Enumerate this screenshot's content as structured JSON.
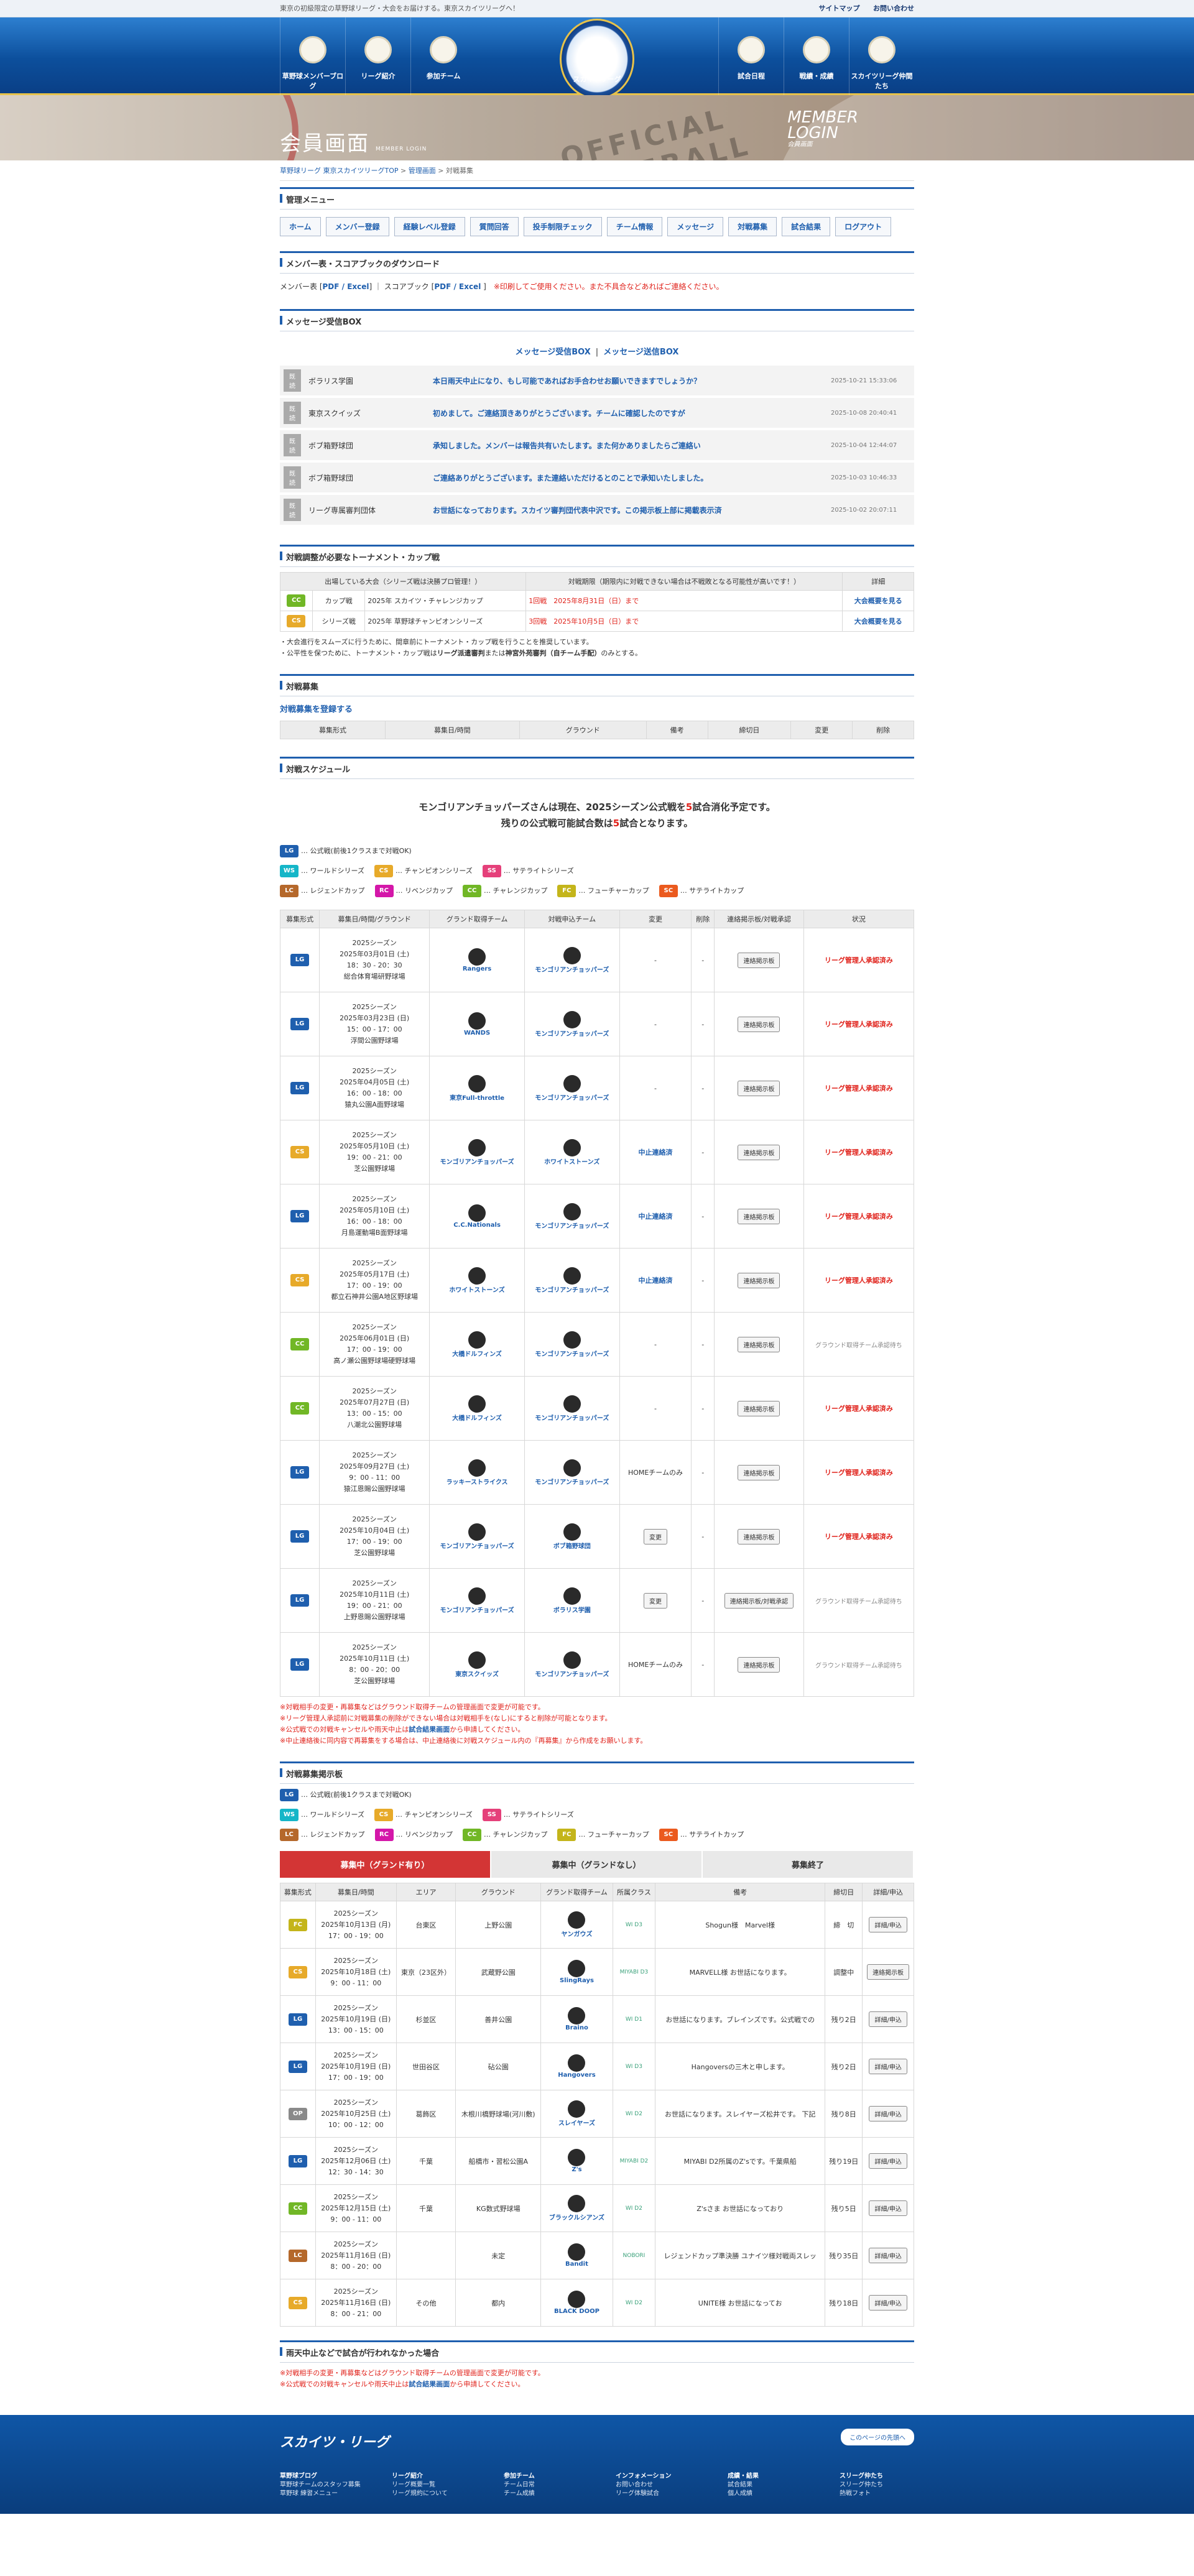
{
  "topbar": {
    "tagline": "東京の初級限定の草野球リーグ・大会をお届けする。東京スカイツリーグへ！",
    "sitemap": "サイトマップ",
    "contact": "お問い合わせ"
  },
  "nav": {
    "left": [
      "草野球メンバーブログ",
      "リーグ紹介",
      "参加チーム"
    ],
    "right": [
      "試合日程",
      "戦績・成績",
      "スカイツリーグ仲間たち"
    ],
    "logo": "スカイツリーグ"
  },
  "hero": {
    "title": "会員画面",
    "title_en": "MEMBER LOGIN",
    "en_title": "MEMBER",
    "en_title2": "LOGIN",
    "en_sub": "会員画面",
    "stamp": "OFFICIAL BASEBALL"
  },
  "breadcrumb": {
    "home": "草野球リーグ 東京スカイツリーグTOP",
    "member": "管理画面",
    "current": "対戦募集"
  },
  "admin_menu": {
    "heading": "管理メニュー",
    "items": [
      "ホーム",
      "メンバー登録",
      "経験レベル登録",
      "質問回答",
      "投手制限チェック",
      "チーム情報",
      "メッセージ",
      "対戦募集",
      "試合結果",
      "ログアウト"
    ]
  },
  "download": {
    "heading": "メンバー表・スコアブックのダウンロード",
    "member_label": "メンバー表 [",
    "member_link": "PDF / Excel",
    "score_label": "] ｜ スコアブック [",
    "score_link": "PDF / Excel",
    "note": "※印刷してご使用ください。また不具合などあればご連絡ください。"
  },
  "messages": {
    "heading": "メッセージ受信BOX",
    "recv": "メッセージ受信BOX",
    "sent": "メッセージ送信BOX",
    "sep": "|",
    "items": [
      {
        "tag": "既読",
        "from": "ボラリス学園",
        "body": "本日雨天中止になり、もし可能であればお手合わせお願いできますでしょうか？",
        "date": "2025-10-21 15:33:06"
      },
      {
        "tag": "既読",
        "from": "東京スクイッズ",
        "body": "初めまして。ご連絡頂きありがとうございます。チームに確認したのですが",
        "date": "2025-10-08 20:40:41"
      },
      {
        "tag": "既読",
        "from": "ボブ箱野球団",
        "body": "承知しました。メンバーは報告共有いたします。また何かありましたらご連絡い",
        "date": "2025-10-04 12:44:07"
      },
      {
        "tag": "既読",
        "from": "ボブ箱野球団",
        "body": "ご連絡ありがとうございます。また連絡いただけるとのことで承知いたしました。",
        "date": "2025-10-03 10:46:33"
      },
      {
        "tag": "既読",
        "from": "リーグ専属審判団体",
        "body": "お世話になっております。スカイツ審判団代表中沢です。この掲示板上部に掲載表示済",
        "date": "2025-10-02 20:07:11"
      }
    ]
  },
  "tournament": {
    "heading": "対戦調整が必要なトーナメント・カップ戦",
    "cols": [
      "出場している大会（シリーズ戦は決勝プロ管理！）",
      "対戦期限（期限内に対戦できない場合は不戦敗となる可能性が高いです！）",
      "詳細"
    ],
    "rows": [
      {
        "badge": "CC",
        "type": "カップ戦",
        "name": "2025年 スカイツ・チャレンジカップ",
        "deadline": "1回戦　2025年8月31日（日）まで",
        "link": "大会概要を見る"
      },
      {
        "badge": "CS",
        "type": "シリーズ戦",
        "name": "2025年 草野球チャンピオンシリーズ",
        "deadline": "3回戦　2025年10月5日（日）まで",
        "link": "大会概要を見る"
      }
    ],
    "note1": "・大会進行をスムーズに行うために、間章前にトーナメント・カップ戦を行うことを推奨しています。",
    "note2_a": "・公平性を保つために、トーナメント・カップ戦は",
    "note2_b": "リーグ派遣審判",
    "note2_c": "または",
    "note2_d": "神宮外苑審判（自チーム手配）",
    "note2_e": "のみとする。"
  },
  "recruit": {
    "heading": "対戦募集",
    "add": "対戦募集を登録する",
    "cols": [
      "募集形式",
      "募集日/時間",
      "グラウンド",
      "備考",
      "締切日",
      "変更",
      "削除"
    ]
  },
  "schedule": {
    "heading": "対戦スケジュール",
    "summary_a": "モンゴリアンチョッパーズさんは現在、2025シーズン公式戦を",
    "summary_n1": "5",
    "summary_b": "試合消化予定です。",
    "summary_c": "残りの公式戦可能試合数は",
    "summary_n2": "5",
    "summary_d": "試合となります。",
    "legend": [
      [
        {
          "b": "LG",
          "t": "… 公式戦(前後1クラスまで対戦OK)"
        }
      ],
      [
        {
          "b": "WS",
          "t": "… ワールドシリーズ"
        },
        {
          "b": "CS",
          "t": "… チャンピオンシリーズ"
        },
        {
          "b": "SS",
          "t": "… サテライトシリーズ"
        }
      ],
      [
        {
          "b": "LC",
          "t": "… レジェンドカップ"
        },
        {
          "b": "RC",
          "t": "… リベンジカップ"
        },
        {
          "b": "CC",
          "t": "… チャレンジカップ"
        },
        {
          "b": "FC",
          "t": "… フューチャーカップ"
        },
        {
          "b": "SC",
          "t": "… サテライトカップ"
        }
      ]
    ],
    "cols": [
      "募集形式",
      "募集日/時間/グラウンド",
      "グランド取得チーム",
      "対戦申込チーム",
      "変更",
      "削除",
      "連絡掲示板/対戦承認",
      "状況"
    ],
    "rows": [
      {
        "b": "LG",
        "season": "2025シーズン",
        "date": "2025年03月01日 (土)",
        "time": "18：30 - 20：30",
        "ground": "総合体育場研野球場",
        "home": "Rangers",
        "away": "モンゴリアンチョッパーズ",
        "change": "-",
        "del": "-",
        "action": "連絡掲示板",
        "status": "リーグ管理人承認済み",
        "sc": "red"
      },
      {
        "b": "LG",
        "season": "2025シーズン",
        "date": "2025年03月23日 (日)",
        "time": "15：00 - 17：00",
        "ground": "浮間公園野球場",
        "home": "WANDS",
        "away": "モンゴリアンチョッパーズ",
        "change": "-",
        "del": "-",
        "action": "連絡掲示板",
        "status": "リーグ管理人承認済み",
        "sc": "red"
      },
      {
        "b": "LG",
        "season": "2025シーズン",
        "date": "2025年04月05日 (土)",
        "time": "16：00 - 18：00",
        "ground": "猿丸公園A面野球場",
        "home": "東京Full-throttle",
        "away": "モンゴリアンチョッパーズ",
        "change": "-",
        "del": "-",
        "action": "連絡掲示板",
        "status": "リーグ管理人承認済み",
        "sc": "red"
      },
      {
        "b": "CS",
        "season": "2025シーズン",
        "date": "2025年05月10日 (土)",
        "time": "19：00 - 21：00",
        "ground": "芝公園野球場",
        "home": "モンゴリアンチョッパーズ",
        "away": "ホワイトストーンズ",
        "change": "中止連絡済",
        "del": "-",
        "action": "連絡掲示板",
        "status": "リーグ管理人承認済み",
        "sc": "red"
      },
      {
        "b": "LG",
        "season": "2025シーズン",
        "date": "2025年05月10日 (土)",
        "time": "16：00 - 18：00",
        "ground": "月島運動場B面野球場",
        "home": "C.C.Nationals",
        "away": "モンゴリアンチョッパーズ",
        "change": "中止連絡済",
        "del": "-",
        "action": "連絡掲示板",
        "status": "リーグ管理人承認済み",
        "sc": "red"
      },
      {
        "b": "CS",
        "season": "2025シーズン",
        "date": "2025年05月17日 (土)",
        "time": "17：00 - 19：00",
        "ground": "都立石神井公園A地区野球場",
        "home": "ホワイトストーンズ",
        "away": "モンゴリアンチョッパーズ",
        "change": "中止連絡済",
        "del": "-",
        "action": "連絡掲示板",
        "status": "リーグ管理人承認済み",
        "sc": "red"
      },
      {
        "b": "CC",
        "season": "2025シーズン",
        "date": "2025年06月01日 (日)",
        "time": "17：00 - 19：00",
        "ground": "高ノ瀬公園野球場硬野球場",
        "home": "大橋ドルフィンズ",
        "away": "モンゴリアンチョッパーズ",
        "change": "-",
        "del": "-",
        "action": "連絡掲示板",
        "status": "グラウンド取得チーム承認待ち",
        "sc": "gray"
      },
      {
        "b": "CC",
        "season": "2025シーズン",
        "date": "2025年07月27日 (日)",
        "time": "13：00 - 15：00",
        "ground": "八潮北公園野球場",
        "home": "大橋ドルフィンズ",
        "away": "モンゴリアンチョッパーズ",
        "change": "-",
        "del": "-",
        "action": "連絡掲示板",
        "status": "リーグ管理人承認済み",
        "sc": "red"
      },
      {
        "b": "LG",
        "season": "2025シーズン",
        "date": "2025年09月27日 (土)",
        "time": "9：00 - 11：00",
        "ground": "猿江恩賜公園野球場",
        "home": "ラッキーストライクス",
        "away": "モンゴリアンチョッパーズ",
        "change": "HOMEチームのみ",
        "del": "-",
        "action": "連絡掲示板",
        "status": "リーグ管理人承認済み",
        "sc": "red"
      },
      {
        "b": "LG",
        "season": "2025シーズン",
        "date": "2025年10月04日 (土)",
        "time": "17：00 - 19：00",
        "ground": "芝公園野球場",
        "home": "モンゴリアンチョッパーズ",
        "away": "ボブ箱野球団",
        "change": "変更",
        "del": "-",
        "action": "連絡掲示板",
        "status": "リーグ管理人承認済み",
        "sc": "red"
      },
      {
        "b": "LG",
        "season": "2025シーズン",
        "date": "2025年10月11日 (土)",
        "time": "19：00 - 21：00",
        "ground": "上野恩賜公園野球場",
        "home": "モンゴリアンチョッパーズ",
        "away": "ボラリス学園",
        "change": "変更",
        "del": "-",
        "action": "連絡掲示板/対戦承認",
        "status": "グラウンド取得チーム承認待ち",
        "sc": "gray"
      },
      {
        "b": "LG",
        "season": "2025シーズン",
        "date": "2025年10月11日 (土)",
        "time": "8：00 - 20：00",
        "ground": "芝公園野球場",
        "home": "東京スクイッズ",
        "away": "モンゴリアンチョッパーズ",
        "change": "HOMEチームのみ",
        "del": "-",
        "action": "連絡掲示板",
        "status": "グラウンド取得チーム承認待ち",
        "sc": "gray"
      }
    ],
    "n1": "※対戦相手の変更・再募集などはグラウンド取得チームの管理画面で変更が可能です。",
    "n2": "※リーグ管理人承認前に対戦募集の削除ができない場合は対戦相手を(なし)にすると削除が可能となります。",
    "n3a": "※公式戦での対戦キャンセルや雨天中止は",
    "n3b": "試合結果画面",
    "n3c": "から申請してください。",
    "n4": "※中止連絡後に同内容で再募集をする場合は、中止連絡後に対戦スケジュール内の『再募集』から作成をお願いします。"
  },
  "board": {
    "heading": "対戦募集掲示板",
    "tabs": [
      "募集中（グランド有り）",
      "募集中（グランドなし）",
      "募集終了"
    ],
    "cols": [
      "募集形式",
      "募集日/時間",
      "エリア",
      "グラウンド",
      "グランド取得チーム",
      "所属クラス",
      "備考",
      "締切日",
      "詳細/申込"
    ],
    "rows": [
      {
        "b": "FC",
        "season": "2025シーズン",
        "date": "2025年10月13日 (月)",
        "time": "17：00 - 19：00",
        "area": "台東区",
        "ground": "上野公園",
        "team": "ヤンガウズ",
        "cls": "WI D3",
        "note": "Shogun様　Marvel様",
        "deadline": "締　切",
        "btn": "詳細/申込"
      },
      {
        "b": "CS",
        "season": "2025シーズン",
        "date": "2025年10月18日 (土)",
        "time": "9：00 - 11：00",
        "area": "東京（23区外）",
        "ground": "武蔵野公園",
        "team": "SlingRays",
        "cls": "MIYABI D3",
        "note": "MARVELL様 お世話になります。",
        "deadline": "調整中",
        "btn": "連絡掲示板"
      },
      {
        "b": "LG",
        "season": "2025シーズン",
        "date": "2025年10月19日 (日)",
        "time": "13：00 - 15：00",
        "area": "杉並区",
        "ground": "善井公園",
        "team": "Braino",
        "cls": "WI D1",
        "note": "お世話になります。ブレインズです。公式戦での",
        "deadline": "残り2日",
        "btn": "詳細/申込"
      },
      {
        "b": "LG",
        "season": "2025シーズン",
        "date": "2025年10月19日 (日)",
        "time": "17：00 - 19：00",
        "area": "世田谷区",
        "ground": "砧公園",
        "team": "Hangovers",
        "cls": "WI D3",
        "note": "Hangoversの三木と申します。",
        "deadline": "残り2日",
        "btn": "詳細/申込"
      },
      {
        "b": "OP",
        "season": "2025シーズン",
        "date": "2025年10月25日 (土)",
        "time": "10：00 - 12：00",
        "area": "葛飾区",
        "ground": "木根川橋野球場(河川敷)",
        "team": "スレイヤーズ",
        "cls": "WI D2",
        "note": "お世話になります。スレイヤーズ松井です。 下記",
        "deadline": "残り8日",
        "btn": "詳細/申込"
      },
      {
        "b": "LG",
        "season": "2025シーズン",
        "date": "2025年12月06日 (土)",
        "time": "12：30 - 14：30",
        "area": "千葉",
        "ground": "船橋市・習松公園A",
        "team": "Z's",
        "cls": "MIYABI D2",
        "note": "MIYABI D2所属のZ'sです。千葉県船",
        "deadline": "残り19日",
        "btn": "詳細/申込"
      },
      {
        "b": "CC",
        "season": "2025シーズン",
        "date": "2025年12月15日 (土)",
        "time": "9：00 - 11：00",
        "area": "千葉",
        "ground": "KG数式野球場",
        "team": "ブラックルシアンズ",
        "cls": "WI D2",
        "note": "Z'sさま お世話になっており",
        "deadline": "残り5日",
        "btn": "詳細/申込"
      },
      {
        "b": "LC",
        "season": "2025シーズン",
        "date": "2025年11月16日 (日)",
        "time": "8：00 - 20：00",
        "area": "",
        "ground": "未定",
        "team": "Bandit",
        "cls": "NOBORI",
        "note": "レジェンドカップ準決勝 ユナイツ様対戦両スレッ",
        "deadline": "残り35日",
        "btn": "詳細/申込"
      },
      {
        "b": "CS",
        "season": "2025シーズン",
        "date": "2025年11月16日 (日)",
        "time": "8：00 - 21：00",
        "area": "その他",
        "ground": "都内",
        "team": "BLACK DOOP",
        "cls": "WI D2",
        "note": "UNITE様 お世話になってお",
        "deadline": "残り18日",
        "btn": "詳細/申込"
      }
    ]
  },
  "rain": {
    "heading": "雨天中止などで試合が行われなかった場合",
    "n1": "※対戦相手の変更・再募集などはグラウンド取得チームの管理画面で変更が可能です。",
    "n2a": "※公式戦での対戦キャンセルや雨天中止は",
    "n2b": "試合結果画面",
    "n2c": "から申請してください。"
  },
  "footer": {
    "logo": "スカイツ・リーグ",
    "top": "このページの先頭へ",
    "cols": [
      {
        "h": "草野球ブログ",
        "l": [
          "草野球チームのスタッフ募集",
          "草野球 練習メニュー"
        ]
      },
      {
        "h": "リーグ紹介",
        "l": [
          "リーグ概要一覧",
          "リーグ規約について"
        ]
      },
      {
        "h": "参加チーム",
        "l": [
          "チーム日常",
          "チーム成績"
        ]
      },
      {
        "h": "インフォメーション",
        "l": [
          "お問い合わせ",
          "リーグ体験試合"
        ]
      },
      {
        "h": "成績・結果",
        "l": [
          "試合結果",
          "個人成績"
        ]
      },
      {
        "h": "スリーグ仲たち",
        "l": [
          "スリーグ仲たち",
          "熱戦フォト"
        ]
      }
    ]
  }
}
